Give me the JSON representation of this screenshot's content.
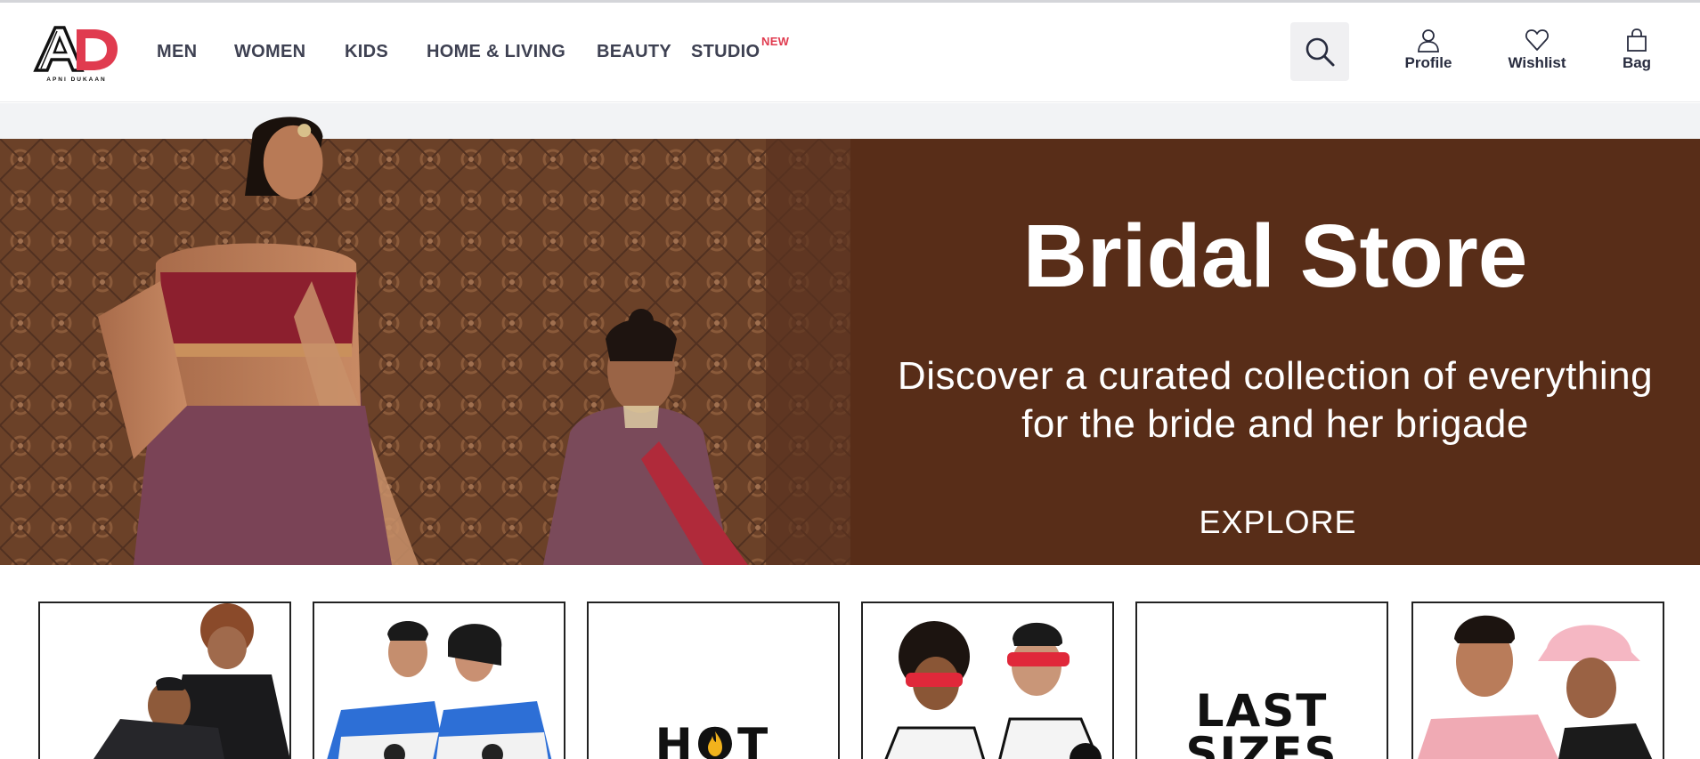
{
  "header": {
    "logo_letters": "AD",
    "logo_tagline": "APNI DUKAAN",
    "nav": [
      {
        "label": "MEN"
      },
      {
        "label": "WOMEN"
      },
      {
        "label": "KIDS"
      },
      {
        "label": "HOME & LIVING"
      },
      {
        "label": "BEAUTY"
      },
      {
        "label": "STUDIO",
        "badge": "NEW"
      }
    ],
    "search_icon": "search-icon",
    "actions": [
      {
        "label": "Profile",
        "icon": "user-icon"
      },
      {
        "label": "Wishlist",
        "icon": "heart-icon"
      },
      {
        "label": "Bag",
        "icon": "bag-icon"
      }
    ]
  },
  "hero": {
    "title": "Bridal Store",
    "subtitle_line1": "Discover a curated collection of everything",
    "subtitle_line2": "for the bride and her brigade",
    "cta": "EXPLORE",
    "bg_color": "#582d18"
  },
  "tiles": [
    {
      "name": "tile-1",
      "text": ""
    },
    {
      "name": "tile-2",
      "text": ""
    },
    {
      "name": "tile-hot",
      "text": "HOT"
    },
    {
      "name": "tile-4",
      "text": ""
    },
    {
      "name": "tile-last-sizes",
      "text_line1": "LAST",
      "text_line2": "SIZES"
    },
    {
      "name": "tile-6",
      "text": ""
    }
  ],
  "colors": {
    "accent": "#e03b4f",
    "text": "#3e4152"
  }
}
